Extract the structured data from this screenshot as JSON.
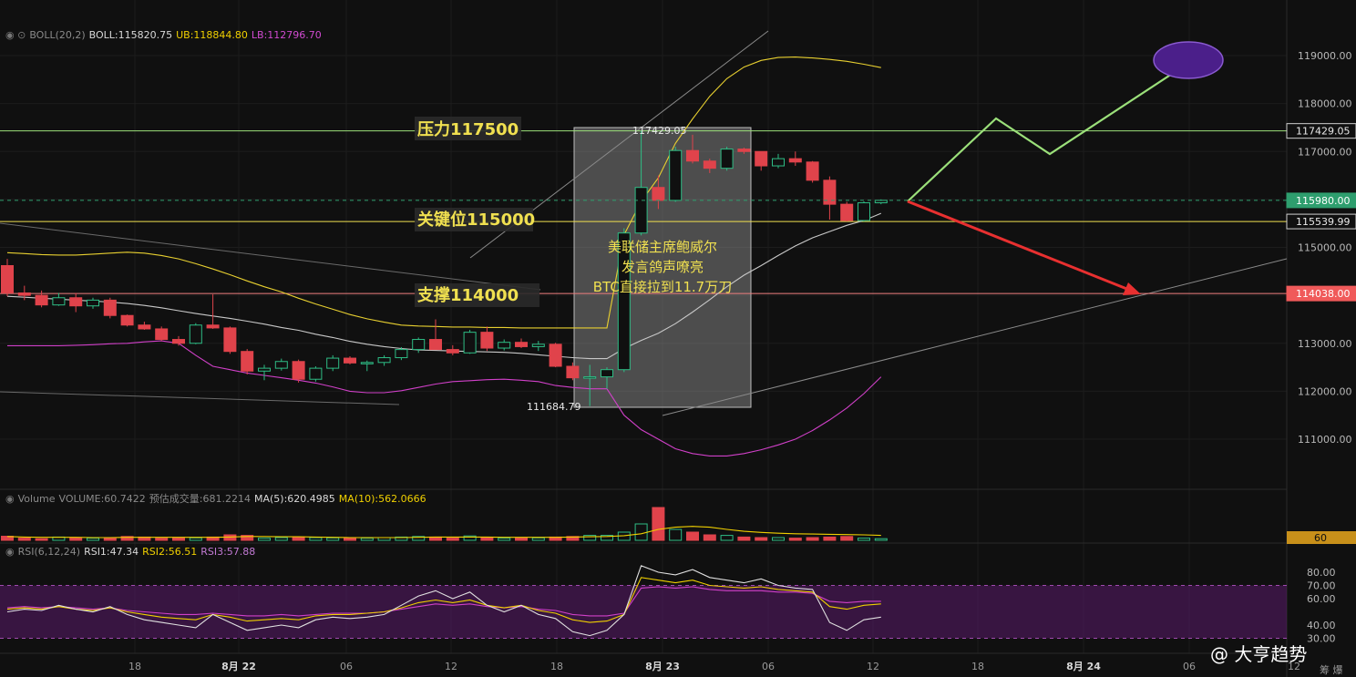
{
  "indicators": {
    "boll": {
      "name": "BOLL(20,2)",
      "boll_label": "BOLL:115820.75",
      "ub_label": "UB:118844.80",
      "lb_label": "LB:112796.70"
    },
    "volume": {
      "name": "Volume",
      "vol_label": "VOLUME:60.7422",
      "est_label": "预估成交量:681.2214",
      "ma5_label": "MA(5):620.4985",
      "ma10_label": "MA(10):562.0666"
    },
    "rsi": {
      "name": "RSI(6,12,24)",
      "rsi1_label": "RSI1:47.34",
      "rsi2_label": "RSI2:56.51",
      "rsi3_label": "RSI3:57.88"
    }
  },
  "annotations": {
    "pressure": "压力117500",
    "key_level": "关键位115000",
    "support": "支撑114000",
    "news_line1": "美联储主席鲍威尔",
    "news_line2": "发言鸽声嘹亮",
    "news_line3": "BTC直接拉到11.7万刀",
    "high_label": "117429.05",
    "low_label": "111684.79"
  },
  "watermark": "@ 大亨趋势",
  "corner_text": "筹 爆",
  "colors": {
    "up": "#2ebd85",
    "down": "#e0434b",
    "boll_mid": "#c8c8c8",
    "boll_ub": "#e8d030",
    "boll_lb": "#d040c8",
    "price_tag_green": "#2e9e6e",
    "price_tag_red": "#f05a5a"
  },
  "chart_data": {
    "type": "candlestick",
    "price_axis": {
      "range": [
        110300,
        119700
      ],
      "ticks": [
        111000,
        112000,
        113000,
        114000,
        115000,
        116000,
        117000,
        118000,
        119000
      ],
      "tick_labels": [
        "111000.00",
        "112000.00",
        "113000.00",
        "114000.00",
        "115000.00",
        "116000.00",
        "117000.00",
        "118000.00",
        "119000.00"
      ]
    },
    "x_axis": {
      "ticks": [
        "18",
        "8月 22",
        "06",
        "12",
        "18",
        "8月 23",
        "06",
        "12",
        "18",
        "8月 24",
        "06",
        "12"
      ]
    },
    "price_tags": [
      {
        "value": 117429.05,
        "label": "117429.05",
        "style": "plain"
      },
      {
        "value": 115980,
        "label": "115980.00",
        "style": "green"
      },
      {
        "value": 115539.99,
        "label": "115539.99",
        "style": "plain"
      },
      {
        "value": 114038,
        "label": "114038.00",
        "style": "red"
      }
    ],
    "horizontal_levels": [
      {
        "value": 117429,
        "color": "#9be07a"
      },
      {
        "value": 115540,
        "color": "#f0e050"
      },
      {
        "value": 114038,
        "color": "#f08080"
      }
    ],
    "current_price": 115980,
    "candles": [
      {
        "o": 114620,
        "h": 114760,
        "l": 113980,
        "c": 114050
      },
      {
        "o": 114050,
        "h": 114200,
        "l": 113900,
        "c": 114000
      },
      {
        "o": 114000,
        "h": 114100,
        "l": 113750,
        "c": 113800
      },
      {
        "o": 113800,
        "h": 114050,
        "l": 113780,
        "c": 113950
      },
      {
        "o": 113950,
        "h": 114050,
        "l": 113650,
        "c": 113780
      },
      {
        "o": 113780,
        "h": 113950,
        "l": 113720,
        "c": 113900
      },
      {
        "o": 113900,
        "h": 113950,
        "l": 113520,
        "c": 113580
      },
      {
        "o": 113580,
        "h": 113600,
        "l": 113350,
        "c": 113380
      },
      {
        "o": 113380,
        "h": 113450,
        "l": 113280,
        "c": 113300
      },
      {
        "o": 113300,
        "h": 113350,
        "l": 113050,
        "c": 113080
      },
      {
        "o": 113080,
        "h": 113150,
        "l": 112950,
        "c": 113000
      },
      {
        "o": 113000,
        "h": 113420,
        "l": 112980,
        "c": 113380
      },
      {
        "o": 113380,
        "h": 114020,
        "l": 113300,
        "c": 113320
      },
      {
        "o": 113320,
        "h": 113350,
        "l": 112780,
        "c": 112830
      },
      {
        "o": 112830,
        "h": 112880,
        "l": 112350,
        "c": 112420
      },
      {
        "o": 112420,
        "h": 112550,
        "l": 112230,
        "c": 112480
      },
      {
        "o": 112480,
        "h": 112680,
        "l": 112430,
        "c": 112620
      },
      {
        "o": 112620,
        "h": 112660,
        "l": 112180,
        "c": 112250
      },
      {
        "o": 112250,
        "h": 112520,
        "l": 112200,
        "c": 112480
      },
      {
        "o": 112480,
        "h": 112750,
        "l": 112420,
        "c": 112690
      },
      {
        "o": 112690,
        "h": 112730,
        "l": 112560,
        "c": 112590
      },
      {
        "o": 112590,
        "h": 112640,
        "l": 112420,
        "c": 112600
      },
      {
        "o": 112600,
        "h": 112750,
        "l": 112530,
        "c": 112700
      },
      {
        "o": 112700,
        "h": 112920,
        "l": 112650,
        "c": 112870
      },
      {
        "o": 112870,
        "h": 113120,
        "l": 112800,
        "c": 113080
      },
      {
        "o": 113080,
        "h": 113500,
        "l": 112980,
        "c": 112870
      },
      {
        "o": 112870,
        "h": 112960,
        "l": 112750,
        "c": 112800
      },
      {
        "o": 112800,
        "h": 113280,
        "l": 112780,
        "c": 113230
      },
      {
        "o": 113230,
        "h": 113350,
        "l": 112840,
        "c": 112900
      },
      {
        "o": 112900,
        "h": 113080,
        "l": 112850,
        "c": 113020
      },
      {
        "o": 113020,
        "h": 113100,
        "l": 112900,
        "c": 112930
      },
      {
        "o": 112930,
        "h": 113050,
        "l": 112840,
        "c": 112980
      },
      {
        "o": 112980,
        "h": 113010,
        "l": 112500,
        "c": 112520
      },
      {
        "o": 112520,
        "h": 112600,
        "l": 112230,
        "c": 112280
      },
      {
        "o": 112280,
        "h": 112550,
        "l": 111690,
        "c": 112300
      },
      {
        "o": 112300,
        "h": 112500,
        "l": 112050,
        "c": 112450
      },
      {
        "o": 112450,
        "h": 115400,
        "l": 112400,
        "c": 115300
      },
      {
        "o": 115300,
        "h": 117430,
        "l": 115250,
        "c": 116250
      },
      {
        "o": 116250,
        "h": 116500,
        "l": 115800,
        "c": 115980
      },
      {
        "o": 115980,
        "h": 117100,
        "l": 115950,
        "c": 117020
      },
      {
        "o": 117020,
        "h": 117350,
        "l": 116750,
        "c": 116800
      },
      {
        "o": 116800,
        "h": 116850,
        "l": 116550,
        "c": 116650
      },
      {
        "o": 116650,
        "h": 117100,
        "l": 116600,
        "c": 117050
      },
      {
        "o": 117050,
        "h": 117080,
        "l": 116950,
        "c": 117000
      },
      {
        "o": 117000,
        "h": 117000,
        "l": 116600,
        "c": 116700
      },
      {
        "o": 116700,
        "h": 116950,
        "l": 116650,
        "c": 116850
      },
      {
        "o": 116850,
        "h": 117000,
        "l": 116700,
        "c": 116780
      },
      {
        "o": 116780,
        "h": 116800,
        "l": 116350,
        "c": 116400
      },
      {
        "o": 116400,
        "h": 116480,
        "l": 115580,
        "c": 115900
      },
      {
        "o": 115900,
        "h": 115950,
        "l": 115540,
        "c": 115560
      },
      {
        "o": 115560,
        "h": 115960,
        "l": 115540,
        "c": 115930
      },
      {
        "o": 115930,
        "h": 116000,
        "l": 115900,
        "c": 115980
      }
    ],
    "boll_mid": [
      113980,
      113960,
      113940,
      113920,
      113900,
      113880,
      113860,
      113830,
      113790,
      113740,
      113680,
      113620,
      113570,
      113520,
      113460,
      113400,
      113330,
      113270,
      113190,
      113120,
      113040,
      112980,
      112930,
      112890,
      112860,
      112850,
      112840,
      112830,
      112820,
      112810,
      112790,
      112760,
      112730,
      112700,
      112680,
      112680,
      112890,
      113060,
      113210,
      113410,
      113650,
      113910,
      114180,
      114420,
      114620,
      114830,
      115030,
      115200,
      115330,
      115460,
      115560,
      115710
    ],
    "boll_ub": [
      114890,
      114870,
      114850,
      114840,
      114840,
      114860,
      114880,
      114900,
      114880,
      114830,
      114760,
      114660,
      114550,
      114430,
      114300,
      114180,
      114070,
      113940,
      113820,
      113710,
      113600,
      113510,
      113440,
      113380,
      113360,
      113350,
      113340,
      113340,
      113330,
      113330,
      113320,
      113320,
      113320,
      113320,
      113320,
      113320,
      115260,
      115960,
      116450,
      117170,
      117680,
      118150,
      118520,
      118760,
      118900,
      118960,
      118970,
      118950,
      118920,
      118880,
      118820,
      118750
    ],
    "boll_lb": [
      112950,
      112950,
      112950,
      112950,
      112960,
      112970,
      112990,
      113000,
      113030,
      113050,
      113000,
      112750,
      112520,
      112450,
      112380,
      112330,
      112280,
      112230,
      112170,
      112090,
      112000,
      111970,
      111970,
      112010,
      112080,
      112150,
      112200,
      112220,
      112240,
      112250,
      112230,
      112200,
      112120,
      112080,
      112050,
      112050,
      111500,
      111200,
      111000,
      110800,
      110700,
      110650,
      110650,
      110700,
      110780,
      110880,
      111000,
      111180,
      111400,
      111650,
      111950,
      112300
    ],
    "volume": [
      15,
      8,
      6,
      12,
      10,
      8,
      10,
      14,
      12,
      8,
      10,
      9,
      12,
      20,
      18,
      8,
      10,
      12,
      10,
      9,
      9,
      8,
      10,
      12,
      14,
      12,
      8,
      16,
      10,
      8,
      10,
      9,
      12,
      14,
      18,
      18,
      30,
      60,
      120,
      40,
      30,
      20,
      18,
      12,
      10,
      10,
      8,
      10,
      12,
      14,
      8,
      6
    ],
    "volume_ma": [
      14,
      12,
      11,
      11,
      11,
      10,
      10,
      11,
      11,
      11,
      11,
      11,
      11,
      12,
      14,
      14,
      13,
      13,
      12,
      11,
      10,
      10,
      10,
      10,
      11,
      12,
      12,
      12,
      12,
      11,
      11,
      11,
      11,
      12,
      13,
      14,
      17,
      24,
      40,
      48,
      51,
      48,
      40,
      33,
      29,
      26,
      24,
      23,
      22,
      21,
      20,
      18
    ],
    "rsi_axis": {
      "range": [
        25,
        90
      ],
      "ticks": [
        30,
        40,
        60,
        70,
        80
      ],
      "tick_labels": [
        "30.00",
        "40.00",
        "60.00",
        "70.00",
        "80.00"
      ],
      "band": [
        30,
        70
      ]
    },
    "rsi1": [
      50,
      52,
      51,
      55,
      52,
      50,
      54,
      48,
      44,
      42,
      40,
      38,
      48,
      42,
      36,
      38,
      40,
      38,
      44,
      46,
      45,
      46,
      48,
      55,
      62,
      66,
      60,
      65,
      55,
      50,
      55,
      48,
      45,
      35,
      32,
      36,
      48,
      85,
      80,
      78,
      82,
      76,
      74,
      72,
      75,
      70,
      68,
      67,
      42,
      36,
      44,
      46
    ],
    "rsi2": [
      52,
      53,
      52,
      54,
      52,
      51,
      53,
      50,
      48,
      46,
      45,
      44,
      48,
      46,
      43,
      44,
      45,
      44,
      47,
      48,
      48,
      49,
      50,
      53,
      57,
      59,
      57,
      59,
      55,
      53,
      55,
      51,
      49,
      44,
      42,
      43,
      48,
      76,
      74,
      72,
      74,
      70,
      69,
      68,
      69,
      67,
      66,
      65,
      54,
      52,
      55,
      56
    ],
    "rsi3": [
      53,
      54,
      53,
      54,
      53,
      52,
      53,
      51,
      50,
      49,
      48,
      48,
      49,
      48,
      47,
      47,
      48,
      47,
      48,
      49,
      49,
      49,
      50,
      52,
      54,
      56,
      55,
      56,
      54,
      53,
      54,
      52,
      51,
      48,
      47,
      47,
      49,
      68,
      69,
      68,
      69,
      67,
      66,
      66,
      66,
      65,
      65,
      64,
      58,
      57,
      58,
      58
    ]
  }
}
